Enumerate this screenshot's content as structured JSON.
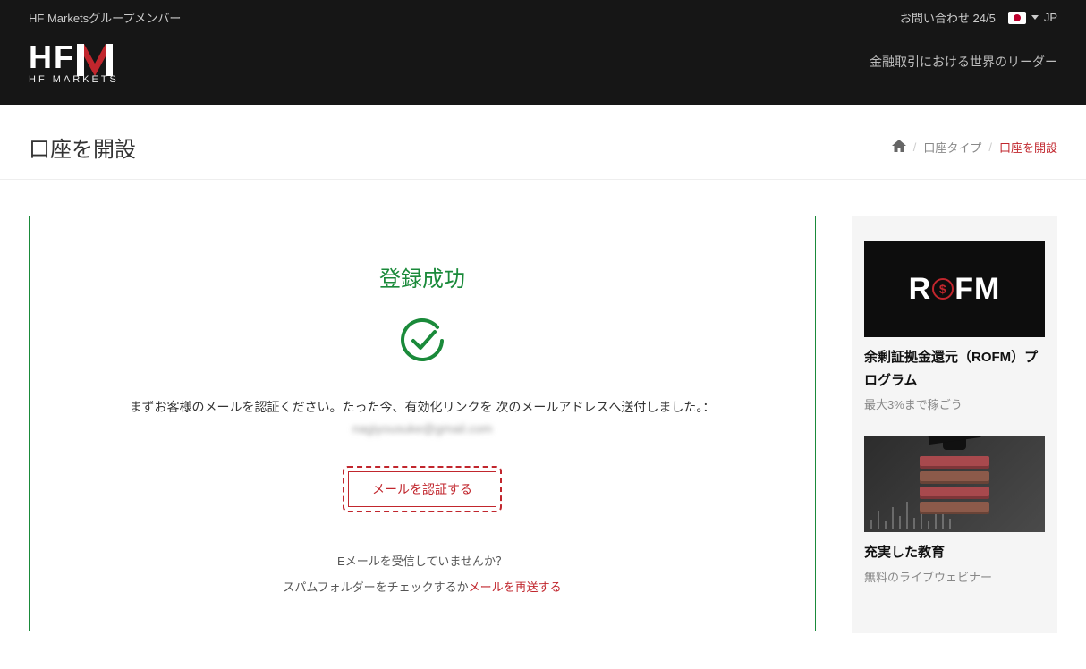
{
  "topbar": {
    "group_member": "HF Marketsグループメンバー",
    "contact": "お問い合わせ 24/5",
    "lang_label": "JP"
  },
  "navbar": {
    "logo_main_h": "HF",
    "logo_sub": "HF MARKETS",
    "tagline": "金融取引における世界のリーダー"
  },
  "breadcrumb": {
    "page_title": "口座を開設",
    "link1": "口座タイプ",
    "current": "口座を開設"
  },
  "success": {
    "title": "登録成功",
    "message": "まずお客様のメールを認証ください。たった今、有効化リンクを 次のメールアドレスへ送付しました。：",
    "email_masked": "nagiyousuke@gmail.com",
    "verify_button": "メールを認証する",
    "not_received": "Eメールを受信していませんか？",
    "spam_hint_prefix": "スパムフォルダーをチェックするか",
    "resend_link": "メールを再送する"
  },
  "sidebar": {
    "promo1": {
      "image_text_r": "R",
      "image_text_fm": "FM",
      "dollar": "$",
      "title": "余剰証拠金還元（ROFM）プログラム",
      "subtitle": "最大3%まで稼ごう"
    },
    "promo2": {
      "title": "充実した教育",
      "subtitle": "無料のライブウェビナー"
    }
  }
}
